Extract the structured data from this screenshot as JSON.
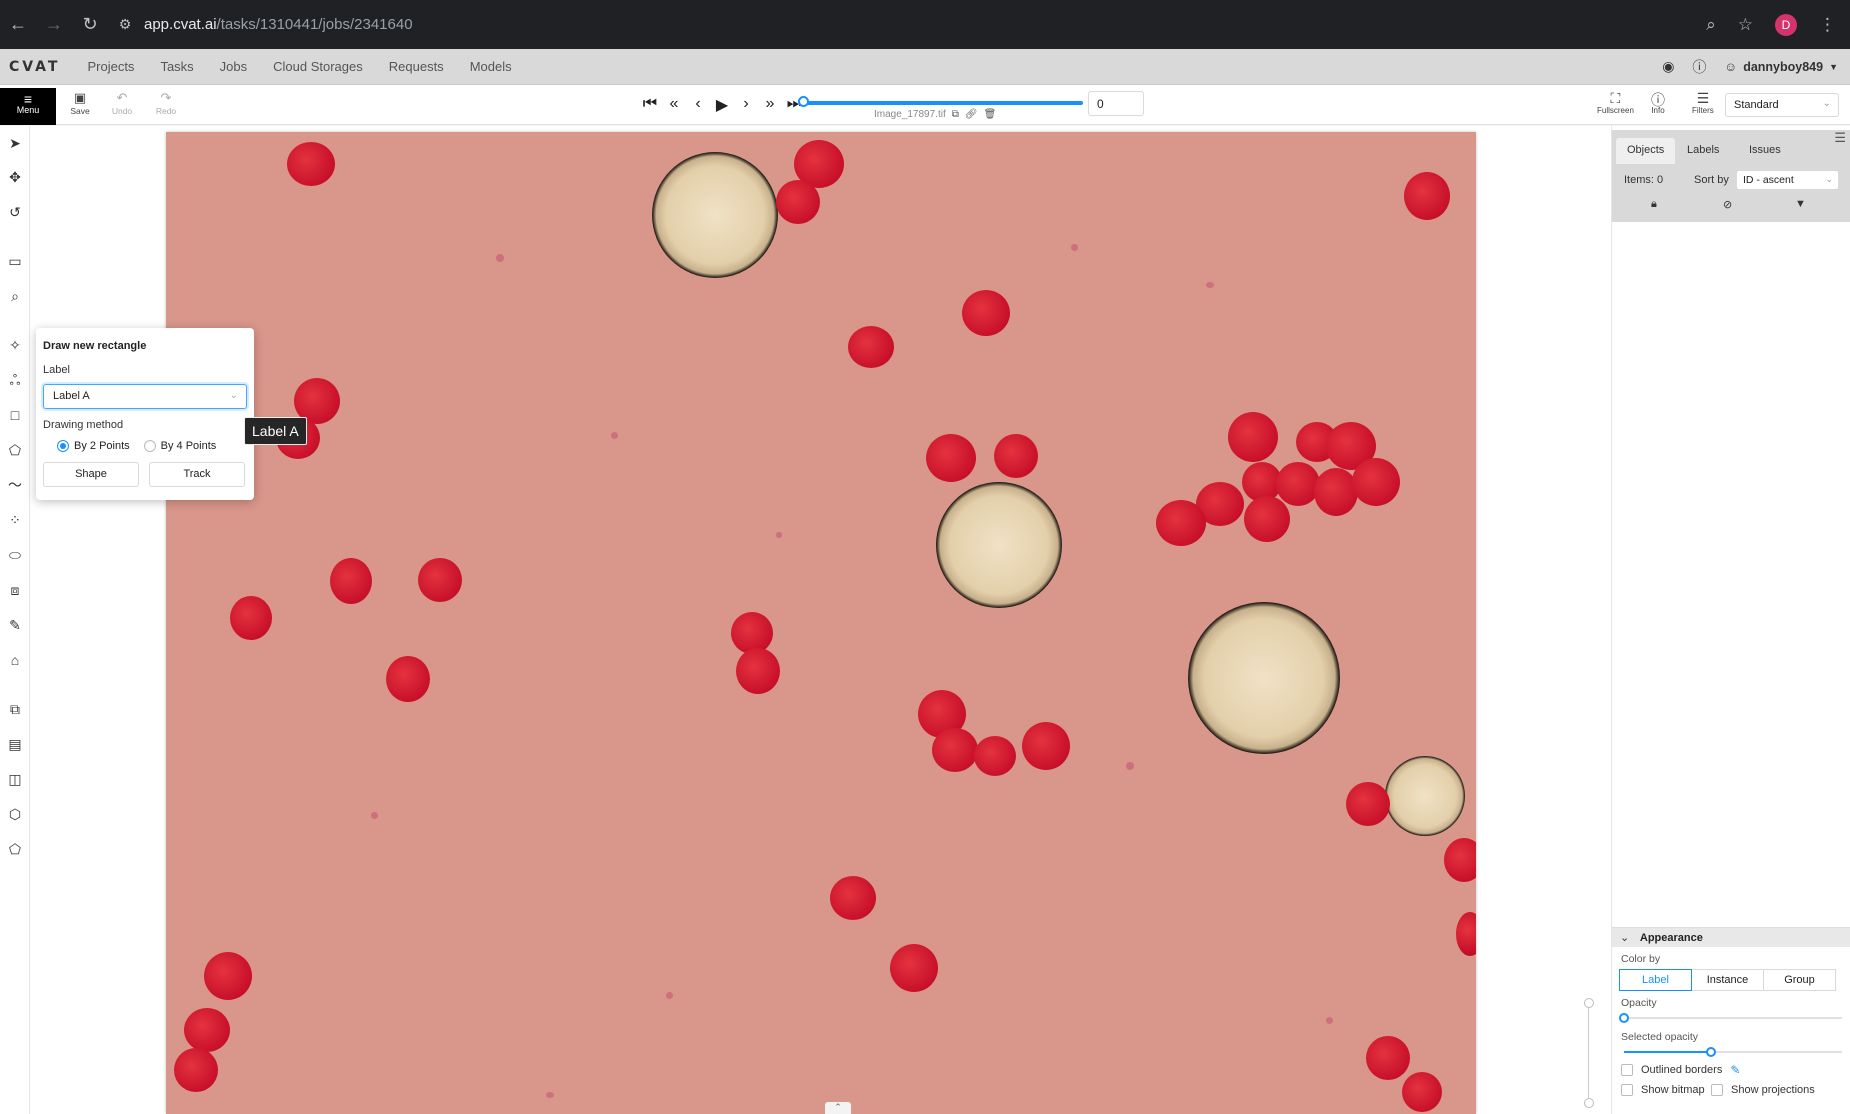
{
  "browser": {
    "url_host": "app.cvat.ai",
    "url_path": "/tasks/1310441/jobs/2341640",
    "avatar_letter": "D"
  },
  "nav": {
    "logo": "CVAT",
    "links": [
      "Projects",
      "Tasks",
      "Jobs",
      "Cloud Storages",
      "Requests",
      "Models"
    ],
    "username": "dannyboy849"
  },
  "toolbar": {
    "menu_label": "Menu",
    "save_label": "Save",
    "undo_label": "Undo",
    "redo_label": "Redo",
    "frame_value": "0",
    "progress": 0,
    "filename": "Image_17897.tif",
    "fullscreen_label": "Fullscreen",
    "info_label": "Info",
    "filters_label": "Filters",
    "workspace": "Standard"
  },
  "draw_popover": {
    "title": "Draw new rectangle",
    "label_caption": "Label",
    "label_value": "Label A",
    "method_caption": "Drawing method",
    "method_options": [
      "By 2 Points",
      "By 4 Points"
    ],
    "selected_method": "By 2 Points",
    "shape_button": "Shape",
    "track_button": "Track"
  },
  "tooltip": "Label A",
  "sidebar": {
    "tabs": [
      "Objects",
      "Labels",
      "Issues"
    ],
    "active_tab": "Objects",
    "items_count": "Items: 0",
    "sort_caption": "Sort by",
    "sort_value": "ID - ascent"
  },
  "appearance": {
    "title": "Appearance",
    "color_by_caption": "Color by",
    "color_by_options": [
      "Label",
      "Instance",
      "Group"
    ],
    "color_by_selected": "Label",
    "opacity_caption": "Opacity",
    "opacity_value": 0,
    "selected_opacity_caption": "Selected opacity",
    "selected_opacity_value": 0.4,
    "outlined_borders": "Outlined borders",
    "show_bitmap": "Show bitmap",
    "show_projections": "Show projections"
  },
  "colors": {
    "accent": "#1890ff",
    "image_background": "#d9968a",
    "cell": "#c8102a"
  }
}
